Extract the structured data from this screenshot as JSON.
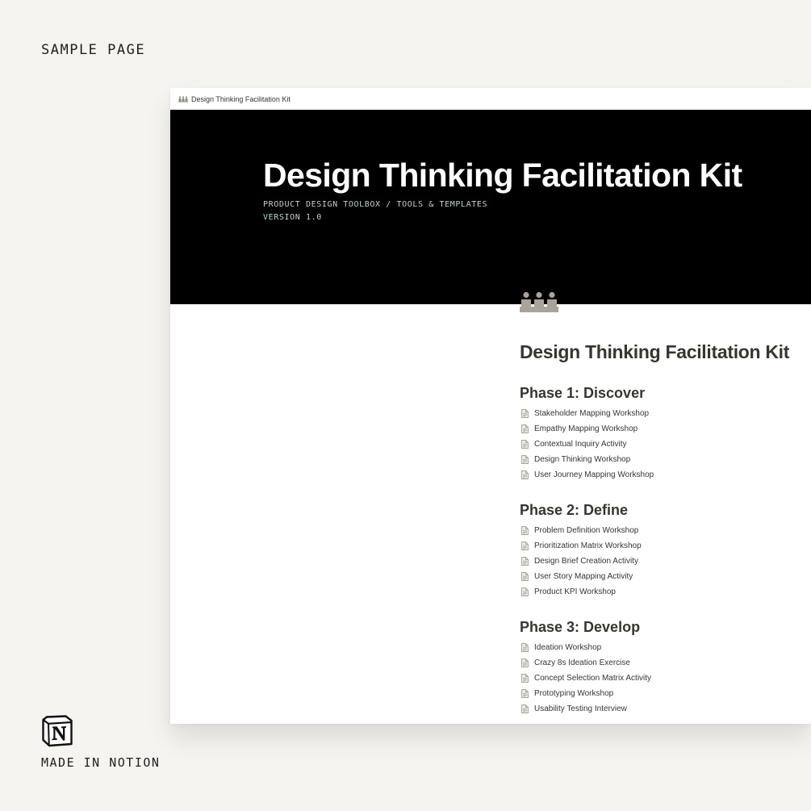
{
  "sample_label": "SAMPLE PAGE",
  "made_in_label": "MADE IN NOTION",
  "breadcrumb": {
    "title": "Design Thinking Facilitation Kit",
    "icon": "people-icon"
  },
  "cover": {
    "title": "Design Thinking Facilitation Kit",
    "subtitle": "PRODUCT DESIGN TOOLBOX / TOOLS & TEMPLATES",
    "version": "VERSION 1.0",
    "background": "#000000",
    "subtitle_color": "#b9d6cf"
  },
  "page": {
    "icon": "people-icon",
    "title": "Design Thinking Facilitation Kit",
    "phases": [
      {
        "title": "Phase 1: Discover",
        "items": [
          "Stakeholder Mapping Workshop",
          "Empathy Mapping Workshop",
          "Contextual Inquiry Activity",
          "Design Thinking Workshop",
          "User Journey Mapping Workshop"
        ]
      },
      {
        "title": "Phase 2: Define",
        "items": [
          "Problem Definition Workshop",
          "Prioritization Matrix Workshop",
          "Design Brief Creation Activity",
          "User Story Mapping Activity",
          "Product KPI Workshop"
        ]
      },
      {
        "title": "Phase 3: Develop",
        "items": [
          "Ideation Workshop",
          "Crazy 8s Ideation Exercise",
          "Concept Selection Matrix Activity",
          "Prototyping Workshop",
          "Usability Testing Interview"
        ]
      }
    ]
  },
  "colors": {
    "background": "#f5f4f0",
    "text": "#37352f",
    "icon_gray": "#a8a49c"
  }
}
